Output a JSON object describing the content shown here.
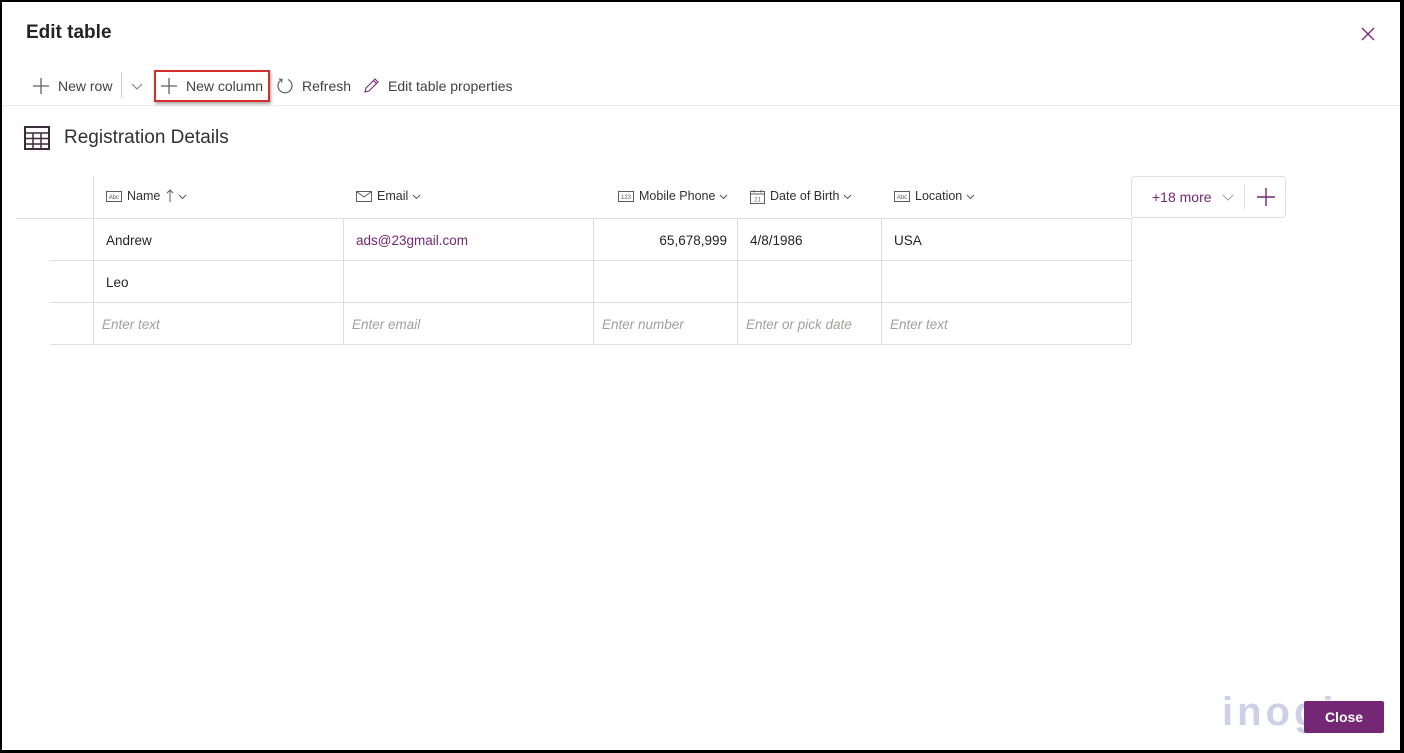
{
  "dialog": {
    "title": "Edit table",
    "close_icon": "close-icon"
  },
  "toolbar": {
    "new_row": "New row",
    "new_column": "New column",
    "refresh": "Refresh",
    "edit_properties": "Edit table properties"
  },
  "table": {
    "name": "Registration Details",
    "columns": [
      {
        "label": "Name",
        "icon": "text-type-icon",
        "sorted": "ascending"
      },
      {
        "label": "Email",
        "icon": "email-type-icon"
      },
      {
        "label": "Mobile Phone",
        "icon": "number-type-icon"
      },
      {
        "label": "Date of Birth",
        "icon": "date-type-icon"
      },
      {
        "label": "Location",
        "icon": "text-type-icon"
      }
    ],
    "rows": [
      [
        "Andrew",
        "ads@23gmail.com",
        "65,678,999",
        "4/8/1986",
        "USA"
      ],
      [
        "Leo",
        "",
        "",
        "",
        ""
      ]
    ],
    "placeholders": [
      "Enter text",
      "Enter email",
      "Enter number",
      "Enter or pick date",
      "Enter text"
    ],
    "more_columns": "+18 more"
  },
  "footer": {
    "close_label": "Close",
    "watermark": "inogic"
  },
  "colors": {
    "accent": "#742774",
    "highlight": "#d32f2f"
  }
}
